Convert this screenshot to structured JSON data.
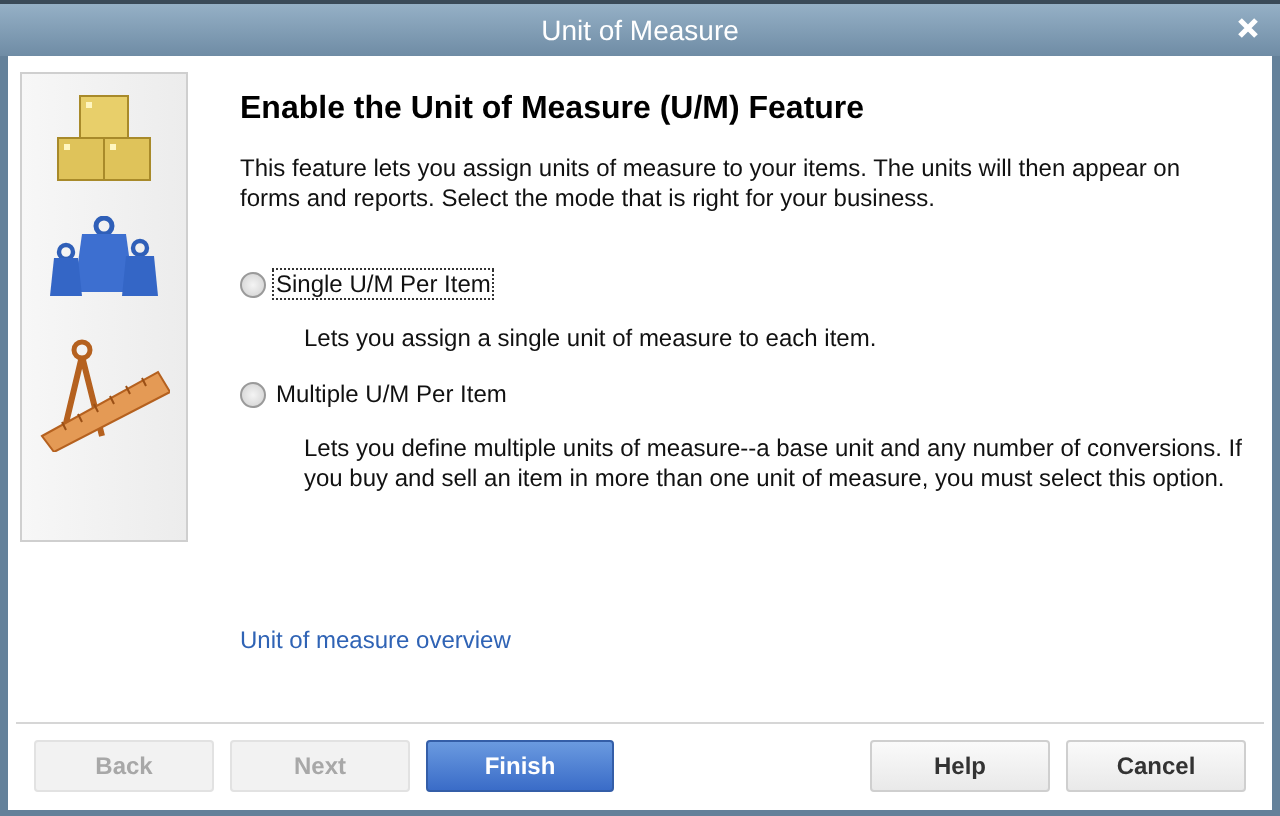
{
  "window": {
    "title": "Unit of Measure"
  },
  "heading": "Enable the Unit of Measure (U/M) Feature",
  "intro": "This feature lets you assign units of measure to your items. The units will then appear on forms and reports. Select the mode that is right for your business.",
  "options": [
    {
      "label": "Single U/M Per Item",
      "description": "Lets you assign a single unit of measure to each item.",
      "selected": false,
      "focused": true
    },
    {
      "label": "Multiple U/M Per Item",
      "description": "Lets you define multiple units of measure--a base unit and any number of conversions. If you buy and sell an item in more than one unit of measure, you must select this option.",
      "selected": false,
      "focused": false
    }
  ],
  "link": "Unit of measure overview",
  "buttons_left": [
    {
      "label": "Back",
      "kind": "normal",
      "disabled": true
    },
    {
      "label": "Next",
      "kind": "normal",
      "disabled": true
    },
    {
      "label": "Finish",
      "kind": "primary",
      "disabled": false
    }
  ],
  "buttons_right": [
    {
      "label": "Help",
      "kind": "normal",
      "disabled": false
    },
    {
      "label": "Cancel",
      "kind": "normal",
      "disabled": false
    }
  ]
}
